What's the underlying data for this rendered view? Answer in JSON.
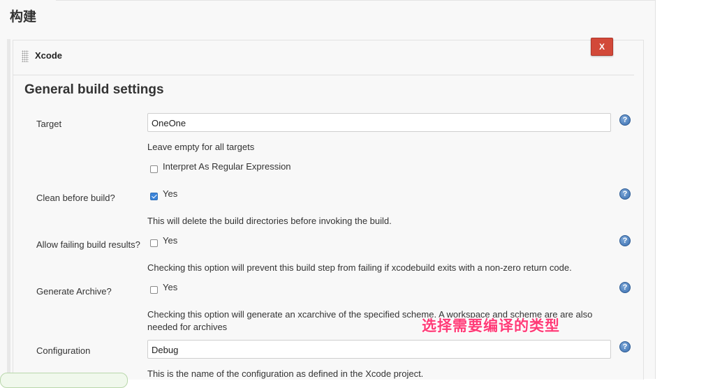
{
  "section": {
    "title": "构建"
  },
  "step": {
    "name": "Xcode",
    "delete_label": "X",
    "heading": "General build settings"
  },
  "fields": {
    "target": {
      "label": "Target",
      "value": "OneOne",
      "hint": "Leave empty for all targets",
      "regex_label": "Interpret As Regular Expression",
      "regex_checked": false
    },
    "clean": {
      "label": "Clean before build?",
      "option": "Yes",
      "checked": true,
      "hint": "This will delete the build directories before invoking the build."
    },
    "allow_failing": {
      "label": "Allow failing build results?",
      "option": "Yes",
      "checked": false,
      "hint": "Checking this option will prevent this build step from failing if xcodebuild exits with a non-zero return code."
    },
    "archive": {
      "label": "Generate Archive?",
      "option": "Yes",
      "checked": false,
      "hint_line1": "Checking this option will generate an xcarchive of the specified scheme. A workspace and scheme are are also",
      "hint_line2": "needed for archives"
    },
    "configuration": {
      "label": "Configuration",
      "value": "Debug",
      "hint": "This is the name of the configuration as defined in the Xcode project."
    }
  },
  "help_icon_glyph": "?",
  "annotation": {
    "text": "选择需要编译的类型",
    "color": "#ff3b77"
  },
  "colors": {
    "delete": "#d24939",
    "checkbox": "#3b84d9",
    "help": "#3a6fb0"
  }
}
